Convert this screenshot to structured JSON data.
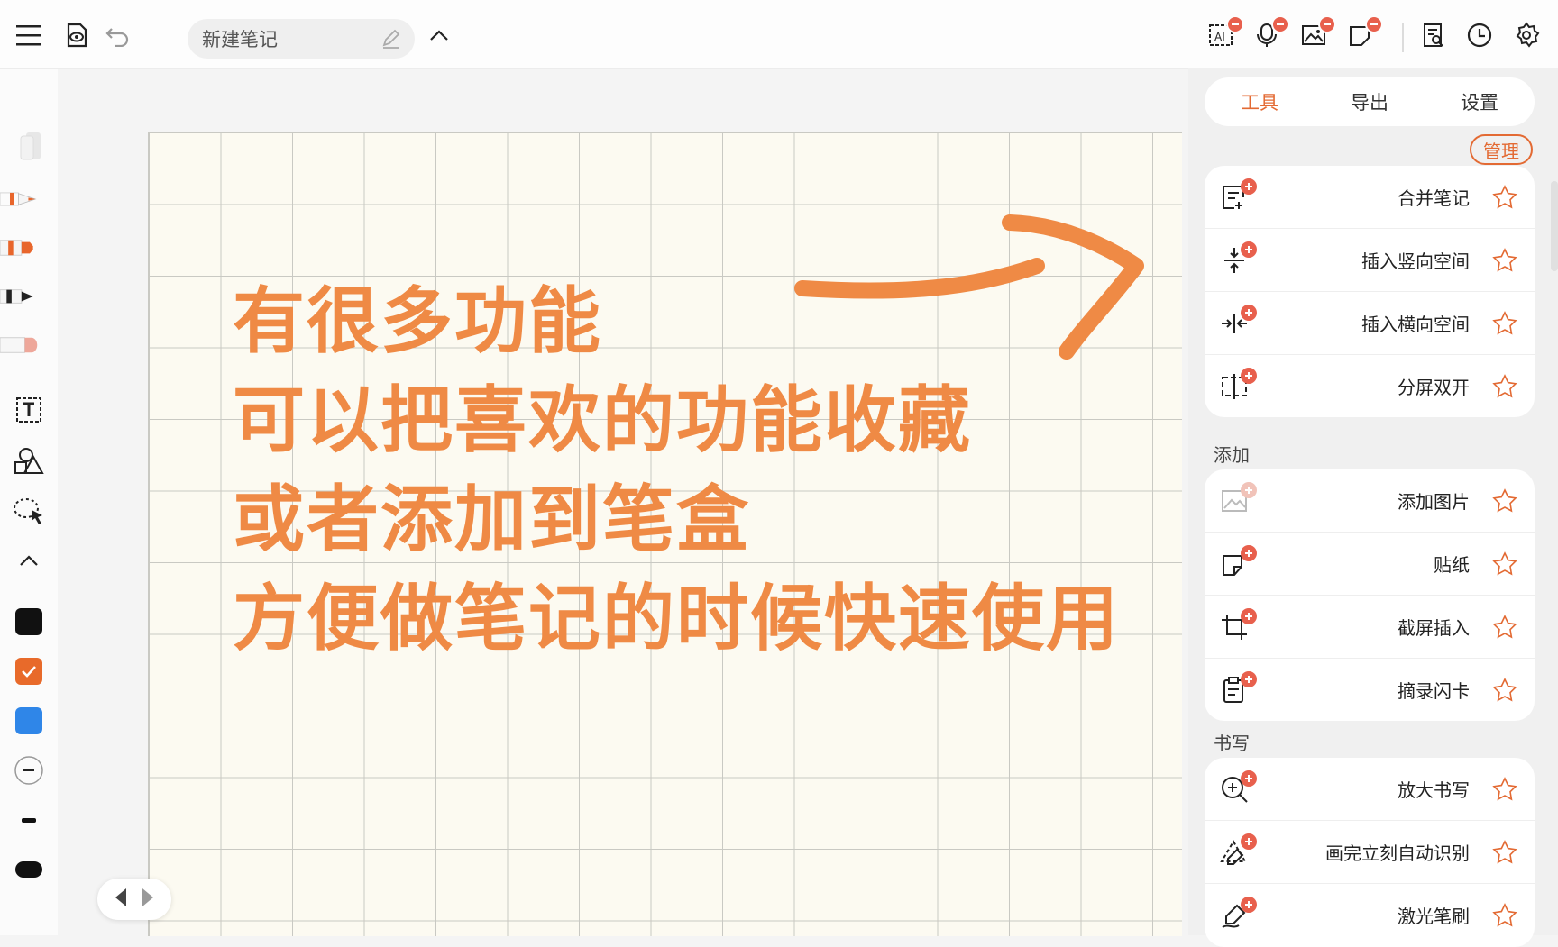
{
  "topbar": {
    "title": "新建笔记",
    "icons": [
      "menu-icon",
      "preview-icon",
      "undo-icon",
      "edit-icon",
      "chevron-up-icon",
      "ai-text-icon",
      "ai-voice-icon",
      "image-recognize-icon",
      "sticker-add-icon",
      "search-note-icon",
      "history-icon",
      "settings-icon"
    ]
  },
  "canvas": {
    "lines": [
      "有很多功能",
      "可以把喜欢的功能收藏",
      "或者添加到笔盒",
      "方便做笔记的时候快速使用"
    ],
    "ink_color": "#ef8a45"
  },
  "left_toolbar": {
    "colors": [
      "#111111",
      "#e86a2a",
      "#2f86e8"
    ],
    "selected_color": "#e86a2a"
  },
  "panel": {
    "tabs": [
      "工具",
      "导出",
      "设置"
    ],
    "active_tab": "工具",
    "manage_label": "管理",
    "group_top": [
      {
        "label": "合并笔记",
        "icon": "merge-note-icon"
      },
      {
        "label": "插入竖向空间",
        "icon": "insert-vertical-space-icon"
      },
      {
        "label": "插入横向空间",
        "icon": "insert-horizontal-space-icon"
      },
      {
        "label": "分屏双开",
        "icon": "split-screen-icon"
      }
    ],
    "section_add": "添加",
    "group_add": [
      {
        "label": "添加图片",
        "icon": "add-image-icon"
      },
      {
        "label": "贴纸",
        "icon": "sticker-icon"
      },
      {
        "label": "截屏插入",
        "icon": "screenshot-insert-icon"
      },
      {
        "label": "摘录闪卡",
        "icon": "flashcard-icon"
      }
    ],
    "section_write": "书写",
    "group_write": [
      {
        "label": "放大书写",
        "icon": "zoom-write-icon"
      },
      {
        "label": "画完立刻自动识别",
        "icon": "shape-recognize-icon"
      },
      {
        "label": "激光笔刷",
        "icon": "laser-brush-icon"
      }
    ],
    "accent": "#e36a33"
  }
}
